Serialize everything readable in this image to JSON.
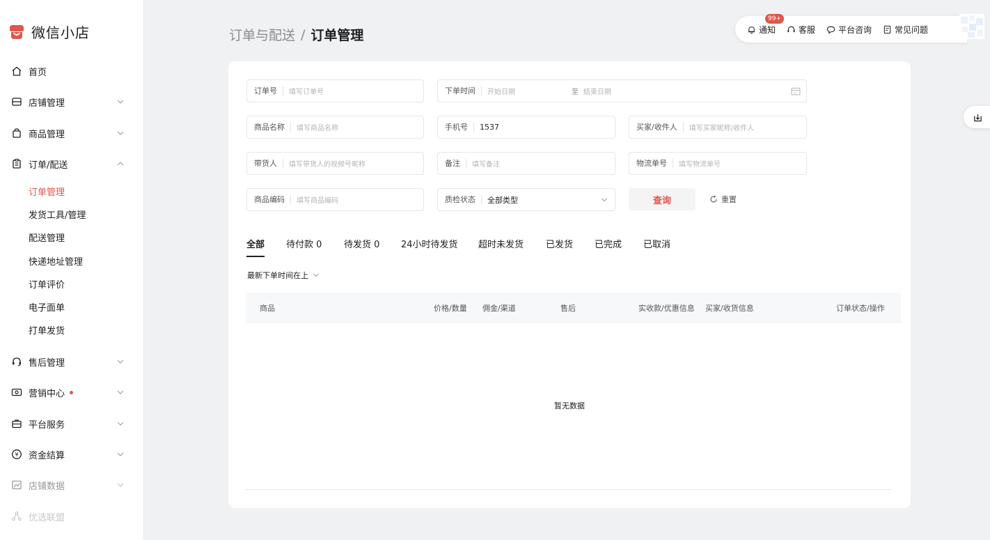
{
  "app": {
    "name": "微信小店",
    "brand_color": "#e0564b"
  },
  "sidebar": {
    "items": [
      {
        "label": "首页",
        "icon": "home-icon"
      },
      {
        "label": "店铺管理",
        "icon": "store-icon"
      },
      {
        "label": "商品管理",
        "icon": "bag-icon"
      },
      {
        "label": "订单/配送",
        "icon": "clipboard-icon"
      },
      {
        "label": "售后管理",
        "icon": "headset-icon"
      },
      {
        "label": "营销中心",
        "icon": "ticket-icon"
      },
      {
        "label": "平台服务",
        "icon": "briefcase-icon"
      },
      {
        "label": "资金结算",
        "icon": "yen-icon"
      },
      {
        "label": "店铺数据",
        "icon": "chart-icon"
      },
      {
        "label": "优选联盟",
        "icon": "network-icon"
      }
    ],
    "sub_items": [
      "订单管理",
      "发货工具/管理",
      "配送管理",
      "快递地址管理",
      "订单评价",
      "电子面单",
      "打单发货"
    ]
  },
  "header": {
    "breadcrumb_parent": "订单与配送",
    "breadcrumb_sep": "/",
    "breadcrumb_current": "订单管理"
  },
  "topbar": {
    "notice": "通知",
    "notice_badge": "99+",
    "service": "客服",
    "consult": "平台咨询",
    "faq": "常见问题"
  },
  "filters": {
    "order_no": {
      "label": "订单号",
      "placeholder": "填写订单号"
    },
    "order_time": {
      "label": "下单时间",
      "start": "开始日期",
      "to": "至",
      "end": "结束日期"
    },
    "product_name": {
      "label": "商品名称",
      "placeholder": "填写商品名称"
    },
    "phone": {
      "label": "手机号",
      "value": "1537"
    },
    "buyer": {
      "label": "买家/收件人",
      "placeholder": "填写买家昵称/收件人"
    },
    "promoter": {
      "label": "带货人",
      "placeholder": "填写带货人的视频号昵称"
    },
    "remark": {
      "label": "备注",
      "placeholder": "填写备注"
    },
    "logistics": {
      "label": "物流单号",
      "placeholder": "填写物流单号"
    },
    "product_code": {
      "label": "商品编码",
      "placeholder": "填写商品编码"
    },
    "qc_status": {
      "label": "质检状态",
      "value": "全部类型"
    },
    "query_label": "查询",
    "reset_label": "重置"
  },
  "tabs": [
    "全部",
    "待付款 0",
    "待发货 0",
    "24小时待发货",
    "超时未发货",
    "已发货",
    "已完成",
    "已取消"
  ],
  "sort_label": "最新下单时间在上",
  "table": {
    "columns": [
      "商品",
      "价格/数量",
      "佣金/渠道",
      "售后",
      "实收款/优惠信息",
      "买家/收货信息",
      "订单状态/操作"
    ],
    "empty_text": "暂无数据"
  }
}
